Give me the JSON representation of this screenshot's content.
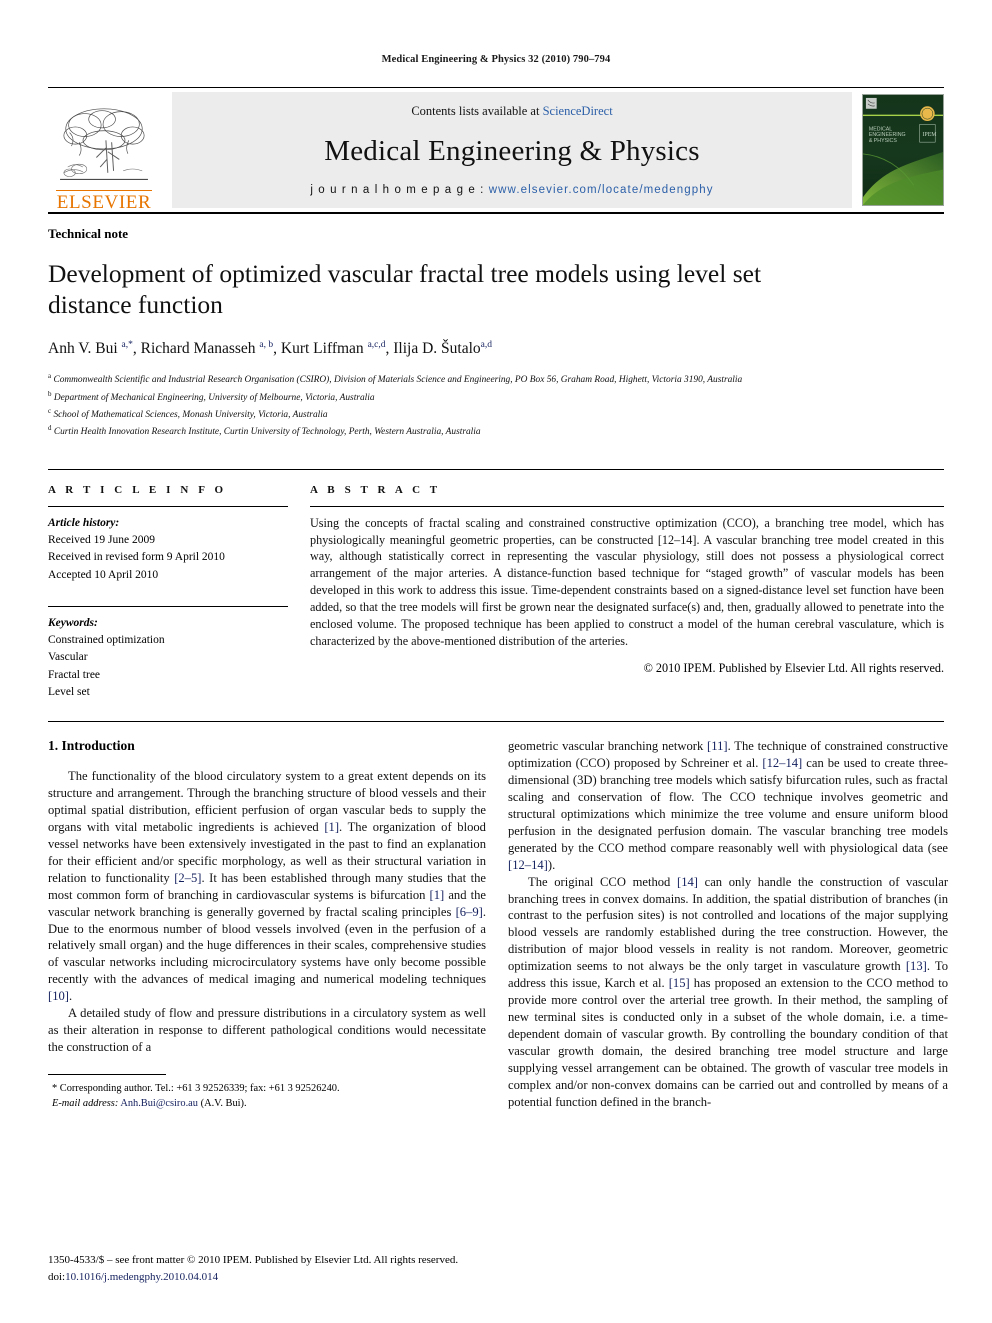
{
  "running_head": "Medical Engineering & Physics 32 (2010) 790–794",
  "masthead": {
    "contents_prefix": "Contents lists available at ",
    "sciencedirect": "ScienceDirect",
    "journal_name": "Medical Engineering & Physics",
    "homepage_label": "j o u r n a l   h o m e p a g e :  ",
    "homepage_url": "www.elsevier.com/locate/medengphy",
    "publisher_name": "ELSEVIER",
    "publisher_icon": "elsevier-tree-logo",
    "cover_title_lines": [
      "MEDICAL",
      "ENGINEERING",
      "& PHYSICS"
    ],
    "colors": {
      "elsevier_orange": "#E77500",
      "link_blue": "#2b5fa8",
      "masthead_grey": "#ececec",
      "cover_green": "#16361c"
    }
  },
  "article": {
    "doctype": "Technical note",
    "title": "Development of optimized vascular fractal tree models using level set distance function",
    "authors_html": "Anh V. Bui <sup>a,*</sup>, Richard Manasseh <sup>a, b</sup>, Kurt Liffman <sup>a,c,d</sup>, Ilija D. Šutalo<sup>a,d</sup>",
    "affiliations": [
      {
        "mark": "a",
        "text": "Commonwealth Scientific and Industrial Research Organisation (CSIRO), Division of Materials Science and Engineering, PO Box 56, Graham Road, Highett, Victoria 3190, Australia"
      },
      {
        "mark": "b",
        "text": "Department of Mechanical Engineering, University of Melbourne, Victoria, Australia"
      },
      {
        "mark": "c",
        "text": "School of Mathematical Sciences, Monash University, Victoria, Australia"
      },
      {
        "mark": "d",
        "text": "Curtin Health Innovation Research Institute, Curtin University of Technology, Perth, Western Australia, Australia"
      }
    ]
  },
  "article_info": {
    "heading": "A R T I C L E    I N F O",
    "history_label": "Article history:",
    "history": [
      "Received 19 June 2009",
      "Received in revised form 9 April 2010",
      "Accepted 10 April 2010"
    ],
    "keywords_label": "Keywords:",
    "keywords": [
      "Constrained optimization",
      "Vascular",
      "Fractal tree",
      "Level set"
    ]
  },
  "abstract": {
    "heading": "A B S T R A C T",
    "text": "Using the concepts of fractal scaling and constrained constructive optimization (CCO), a branching tree model, which has physiologically meaningful geometric properties, can be constructed [12–14]. A vascular branching tree model created in this way, although statistically correct in representing the vascular physiology, still does not possess a physiological correct arrangement of the major arteries. A distance-function based technique for “staged growth” of vascular models has been developed in this work to address this issue. Time-dependent constraints based on a signed-distance level set function have been added, so that the tree models will first be grown near the designated surface(s) and, then, gradually allowed to penetrate into the enclosed volume. The proposed technique has been applied to construct a model of the human cerebral vasculature, which is characterized by the above-mentioned distribution of the arteries.",
    "copyright": "© 2010 IPEM. Published by Elsevier Ltd. All rights reserved."
  },
  "body": {
    "section_number_title": "1. Introduction",
    "left_paragraphs": [
      "The functionality of the blood circulatory system to a great extent depends on its structure and arrangement. Through the branching structure of blood vessels and their optimal spatial distribution, efficient perfusion of organ vascular beds to supply the organs with vital metabolic ingredients is achieved [1]. The organization of blood vessel networks have been extensively investigated in the past to find an explanation for their efficient and/or specific morphology, as well as their structural variation in relation to functionality [2–5]. It has been established through many studies that the most common form of branching in cardiovascular systems is bifurcation [1] and the vascular network branching is generally governed by fractal scaling principles [6–9]. Due to the enormous number of blood vessels involved (even in the perfusion of a relatively small organ) and the huge differences in their scales, comprehensive studies of vascular networks including microcirculatory systems have only become possible recently with the advances of medical imaging and numerical modeling techniques [10].",
      "A detailed study of flow and pressure distributions in a circulatory system as well as their alteration in response to different pathological conditions would necessitate the construction of a"
    ],
    "right_paragraphs": [
      "geometric vascular branching network [11]. The technique of constrained constructive optimization (CCO) proposed by Schreiner et al. [12–14] can be used to create three-dimensional (3D) branching tree models which satisfy bifurcation rules, such as fractal scaling and conservation of flow. The CCO technique involves geometric and structural optimizations which minimize the tree volume and ensure uniform blood perfusion in the designated perfusion domain. The vascular branching tree models generated by the CCO method compare reasonably well with physiological data (see [12–14]).",
      "The original CCO method [14] can only handle the construction of vascular branching trees in convex domains. In addition, the spatial distribution of branches (in contrast to the perfusion sites) is not controlled and locations of the major supplying blood vessels are randomly established during the tree construction. However, the distribution of major blood vessels in reality is not random. Moreover, geometric optimization seems to not always be the only target in vasculature growth [13]. To address this issue, Karch et al. [15] has proposed an extension to the CCO method to provide more control over the arterial tree growth. In their method, the sampling of new terminal sites is conducted only in a subset of the whole domain, i.e. a time-dependent domain of vascular growth. By controlling the boundary condition of that vascular growth domain, the desired branching tree model structure and large supplying vessel arrangement can be obtained. The growth of vascular tree models in complex and/or non-convex domains can be carried out and controlled by means of a potential function defined in the branch-"
    ]
  },
  "footnotes": {
    "corresponding": "* Corresponding author. Tel.: +61 3 92526339; fax: +61 3 92526240.",
    "email_label": "E-mail address:",
    "email": "Anh.Bui@csiro.au",
    "email_suffix": "(A.V. Bui)."
  },
  "page_footer": {
    "issn_line": "1350-4533/$ – see front matter © 2010 IPEM. Published by Elsevier Ltd. All rights reserved.",
    "doi_prefix": "doi:",
    "doi": "10.1016/j.medengphy.2010.04.014"
  }
}
